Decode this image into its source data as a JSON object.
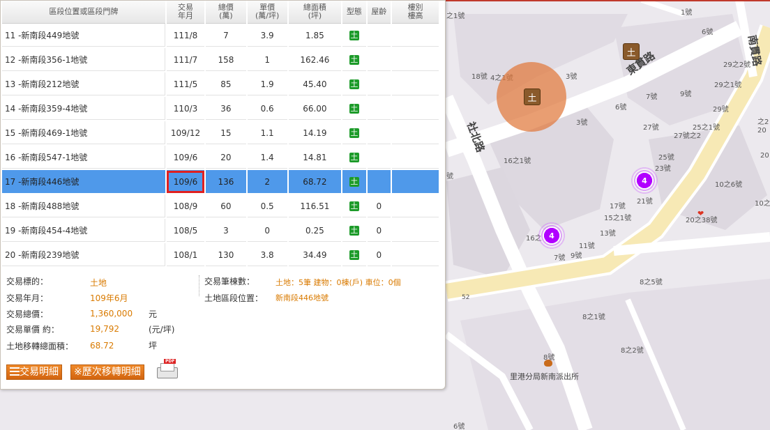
{
  "table": {
    "headers": {
      "location": "區段位置或區段門牌",
      "month_l1": "交易",
      "month_l2": "年月",
      "total_l1": "總價",
      "total_l2": "(萬)",
      "unit_l1": "單價",
      "unit_l2": "(萬/坪)",
      "area_l1": "總面積",
      "area_l2": "(坪)",
      "type": "型態",
      "age": "屋齡",
      "floor_l1": "樓別",
      "floor_l2": "樓高"
    },
    "rows": [
      {
        "location": "11 -新南段449地號",
        "month": "111/8",
        "total": "7",
        "unit": "3.9",
        "area": "1.85",
        "age": "",
        "floor": ""
      },
      {
        "location": "12 -新南段356-1地號",
        "month": "111/7",
        "total": "158",
        "unit": "1",
        "area": "162.46",
        "age": "",
        "floor": ""
      },
      {
        "location": "13 -新南段212地號",
        "month": "111/5",
        "total": "85",
        "unit": "1.9",
        "area": "45.40",
        "age": "",
        "floor": ""
      },
      {
        "location": "14 -新南段359-4地號",
        "month": "110/3",
        "total": "36",
        "unit": "0.6",
        "area": "66.00",
        "age": "",
        "floor": ""
      },
      {
        "location": "15 -新南段469-1地號",
        "month": "109/12",
        "total": "15",
        "unit": "1.1",
        "area": "14.19",
        "age": "",
        "floor": ""
      },
      {
        "location": "16 -新南段547-1地號",
        "month": "109/6",
        "total": "20",
        "unit": "1.4",
        "area": "14.81",
        "age": "",
        "floor": ""
      },
      {
        "location": "17 -新南段446地號",
        "month": "109/6",
        "total": "136",
        "unit": "2",
        "area": "68.72",
        "age": "",
        "floor": ""
      },
      {
        "location": "18 -新南段488地號",
        "month": "108/9",
        "total": "60",
        "unit": "0.5",
        "area": "116.51",
        "age": "0",
        "floor": ""
      },
      {
        "location": "19 -新南段454-4地號",
        "month": "108/5",
        "total": "3",
        "unit": "0",
        "area": "0.25",
        "age": "0",
        "floor": ""
      },
      {
        "location": "20 -新南段239地號",
        "month": "108/1",
        "total": "130",
        "unit": "3.8",
        "area": "34.49",
        "age": "0",
        "floor": ""
      }
    ],
    "type_icon": "土",
    "selected_row": 6
  },
  "detail": {
    "target_label": "交易標的：",
    "target_value": "土地",
    "month_label": "交易年月：",
    "month_value": "109年6月",
    "total_label": "交易總價：",
    "total_value": "1,360,000",
    "total_unit": "元",
    "unit_label": "交易單價 約：",
    "unit_value": "19,792",
    "unit_unit": "(元/坪)",
    "area_label": "土地移轉總面積：",
    "area_value": "68.72",
    "area_unit": "坪",
    "count_label": "交易筆棟數：",
    "count_value": "土地：5筆 建物：0棟(戶) 車位：0個",
    "land_loc_label": "土地區段位置：",
    "land_loc_value": "新南段446地號"
  },
  "buttons": {
    "detail": "交易明細",
    "history": "※歷次移轉明細",
    "pdf_label": "PDF"
  },
  "map": {
    "roads": {
      "dongguan": "東貫路",
      "shebei": "社北路",
      "nanguan": "南貫路"
    },
    "clusters": [
      "4",
      "4"
    ],
    "land_marker": "土",
    "poi": "里港分局新南派出所",
    "house_numbers": [
      "之1號",
      "1號",
      "6號",
      "18號",
      "4之1號",
      "3號",
      "7號",
      "9號",
      "6號",
      "3號",
      "27號",
      "25之1號",
      "27號之2",
      "29之2號",
      "29之1號",
      "29號",
      "16之1號",
      "25號",
      "23號",
      "10之6號",
      "17號",
      "21號",
      "15之1號",
      "13號",
      "16之",
      "7號",
      "9號",
      "11號",
      "20之38號",
      "8之5號",
      "8之1號",
      "8之2號",
      "8號",
      "6號",
      "號",
      "10之",
      "20",
      "之2",
      "20"
    ],
    "road_marker": "52"
  }
}
